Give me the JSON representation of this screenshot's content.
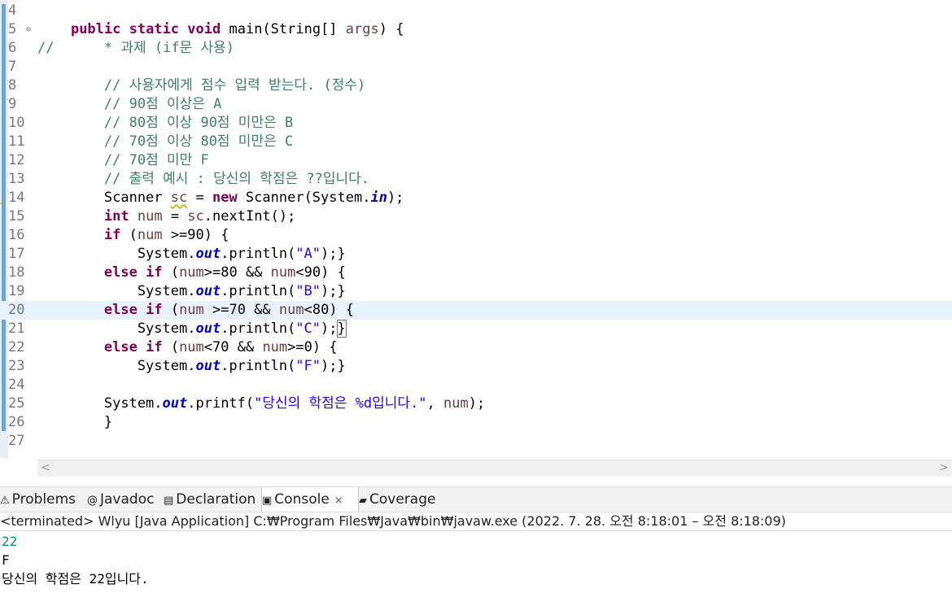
{
  "editor": {
    "lines": [
      {
        "n": "4",
        "html": ""
      },
      {
        "n": "5",
        "html": "    <span class=\"kw\">public</span> <span class=\"kw\">static</span> <span class=\"kw\">void</span> main(String[] <span class=\"var\">args</span>) {",
        "fold": true
      },
      {
        "n": "6",
        "html": "<span class=\"cm\">//      * 과제 (if문 사용)</span>"
      },
      {
        "n": "7",
        "html": ""
      },
      {
        "n": "8",
        "html": "        <span class=\"cm\">// 사용자에게 점수 입력 받는다. (정수)</span>"
      },
      {
        "n": "9",
        "html": "        <span class=\"cm\">// 90점 이상은 A</span>"
      },
      {
        "n": "10",
        "html": "        <span class=\"cm\">// 80점 이상 90점 미만은 B</span>"
      },
      {
        "n": "11",
        "html": "        <span class=\"cm\">// 70점 이상 80점 미만은 C</span>"
      },
      {
        "n": "12",
        "html": "        <span class=\"cm\">// 70점 미만 F</span>"
      },
      {
        "n": "13",
        "html": "        <span class=\"cm\">// 출력 예시 : 당신의 학점은 ??입니다.</span>"
      },
      {
        "n": "14",
        "html": "        Scanner <span class=\"var warn\">sc</span> = <span class=\"kw\">new</span> Scanner(System.<span class=\"fld\">in</span>);",
        "warn": true
      },
      {
        "n": "15",
        "html": "        <span class=\"kw\">int</span> <span class=\"var\">num</span> = <span class=\"var\">sc</span>.nextInt();"
      },
      {
        "n": "16",
        "html": "        <span class=\"kw\">if</span> (<span class=\"var\">num</span> &gt;=90) {"
      },
      {
        "n": "17",
        "html": "            System.<span class=\"fld\">out</span>.println(<span class=\"str\">\"A\"</span>);}"
      },
      {
        "n": "18",
        "html": "        <span class=\"kw\">else</span> <span class=\"kw\">if</span> (<span class=\"var\">num</span>&gt;=80 &amp;&amp; <span class=\"var\">num</span>&lt;90) {"
      },
      {
        "n": "19",
        "html": "            System.<span class=\"fld\">out</span>.println(<span class=\"str\">\"B\"</span>);}"
      },
      {
        "n": "20",
        "html": "        <span class=\"kw\">else</span> <span class=\"kw\">if</span> (<span class=\"var\">num</span> &gt;=70 &amp;&amp; <span class=\"var\">num</span>&lt;80) {",
        "current": true
      },
      {
        "n": "21",
        "html": "            System.<span class=\"fld\">out</span>.println(<span class=\"str\">\"C\"</span>);<span style=\"outline:1px solid #777\">}</span>"
      },
      {
        "n": "22",
        "html": "        <span class=\"kw\">else</span> <span class=\"kw\">if</span> (<span class=\"var\">num</span>&lt;70 &amp;&amp; <span class=\"var\">num</span>&gt;=0) {"
      },
      {
        "n": "23",
        "html": "            System.<span class=\"fld\">out</span>.println(<span class=\"str\">\"F\"</span>);}"
      },
      {
        "n": "24",
        "html": ""
      },
      {
        "n": "25",
        "html": "        System.<span class=\"fld\">out</span>.printf(<span class=\"str\">\"당신의 학점은 %d입니다.\"</span>, <span class=\"var\">num</span>);"
      },
      {
        "n": "26",
        "html": "        }"
      },
      {
        "n": "27",
        "html": ""
      }
    ]
  },
  "tabs": [
    {
      "label": "Problems",
      "icon": "problems-icon",
      "glyph": "⚠"
    },
    {
      "label": "Javadoc",
      "icon": "javadoc-icon",
      "glyph": "@"
    },
    {
      "label": "Declaration",
      "icon": "declaration-icon",
      "glyph": "▤"
    },
    {
      "label": "Console",
      "icon": "console-icon",
      "glyph": "▣",
      "active": true,
      "close": "×"
    },
    {
      "label": "Coverage",
      "icon": "coverage-icon",
      "glyph": "▰"
    }
  ],
  "console": {
    "status": "<terminated> Wlyu [Java Application] C:₩Program Files₩Java₩bin₩javaw.exe  (2022. 7. 28. 오전 8:18:01 – 오전 8:18:09)",
    "input": "22",
    "out1": "F",
    "out2": "당신의 학점은 22입니다."
  }
}
